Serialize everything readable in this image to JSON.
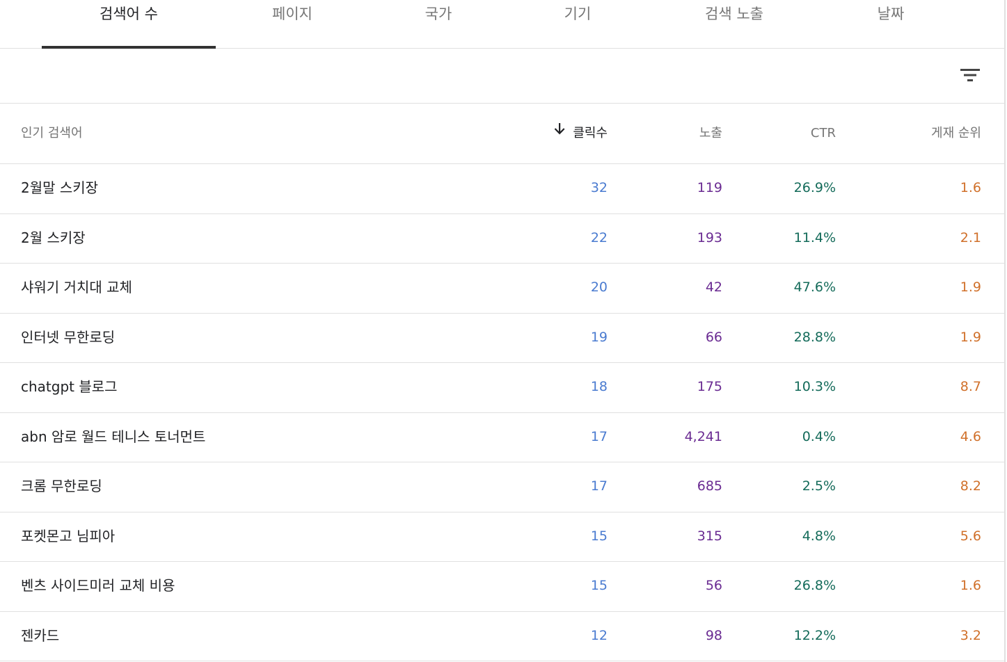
{
  "tabs": [
    {
      "label": "검색어 수",
      "active": true
    },
    {
      "label": "페이지",
      "active": false
    },
    {
      "label": "국가",
      "active": false
    },
    {
      "label": "기기",
      "active": false
    },
    {
      "label": "검색 노출",
      "active": false
    },
    {
      "label": "날짜",
      "active": false
    }
  ],
  "toolbar": {
    "filter_icon": "filter-list-icon"
  },
  "table": {
    "headers": {
      "query": "인기 검색어",
      "clicks": "클릭수",
      "impressions": "노출",
      "ctr": "CTR",
      "position": "게재 순위"
    },
    "sort_icon": "arrow-down-icon",
    "colors": {
      "query": "#202124",
      "clicks": "#4a7bd0",
      "impressions": "#6a2b92",
      "ctr": "#146b5a",
      "position": "#d0702a"
    },
    "rows": [
      {
        "query": "2월말 스키장",
        "clicks": "32",
        "impressions": "119",
        "ctr": "26.9%",
        "position": "1.6"
      },
      {
        "query": "2월 스키장",
        "clicks": "22",
        "impressions": "193",
        "ctr": "11.4%",
        "position": "2.1"
      },
      {
        "query": "샤워기 거치대 교체",
        "clicks": "20",
        "impressions": "42",
        "ctr": "47.6%",
        "position": "1.9"
      },
      {
        "query": "인터넷 무한로딩",
        "clicks": "19",
        "impressions": "66",
        "ctr": "28.8%",
        "position": "1.9"
      },
      {
        "query": "chatgpt 블로그",
        "clicks": "18",
        "impressions": "175",
        "ctr": "10.3%",
        "position": "8.7"
      },
      {
        "query": "abn 암로 월드 테니스 토너먼트",
        "clicks": "17",
        "impressions": "4,241",
        "ctr": "0.4%",
        "position": "4.6"
      },
      {
        "query": "크롬 무한로딩",
        "clicks": "17",
        "impressions": "685",
        "ctr": "2.5%",
        "position": "8.2"
      },
      {
        "query": "포켓몬고 님피아",
        "clicks": "15",
        "impressions": "315",
        "ctr": "4.8%",
        "position": "5.6"
      },
      {
        "query": "벤츠 사이드미러 교체 비용",
        "clicks": "15",
        "impressions": "56",
        "ctr": "26.8%",
        "position": "1.6"
      },
      {
        "query": "젠카드",
        "clicks": "12",
        "impressions": "98",
        "ctr": "12.2%",
        "position": "3.2"
      }
    ]
  }
}
